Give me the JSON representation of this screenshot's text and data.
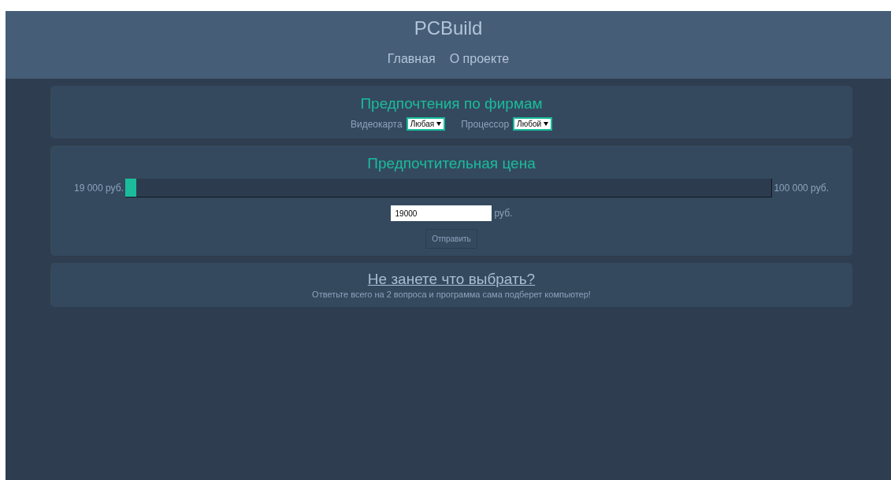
{
  "header": {
    "title": "PCBuild",
    "nav": [
      {
        "label": "Главная"
      },
      {
        "label": "О проекте"
      }
    ]
  },
  "brands": {
    "title": "Предпочтения по фирмам",
    "selects": [
      {
        "label": "Видеокарта",
        "value": "Любая"
      },
      {
        "label": "Процессор",
        "value": "Любой"
      }
    ]
  },
  "price": {
    "title": "Предпочтительная цена",
    "min_label": "19 000 руб.",
    "max_label": "100 000 руб.",
    "level": 0,
    "value": "19000",
    "unit": "руб.",
    "submit": "Отправить"
  },
  "help": {
    "link": "Не занете что выбрать?",
    "text": "Ответьте всего на 2 вопроса и программа сама подберет компьютер!"
  }
}
